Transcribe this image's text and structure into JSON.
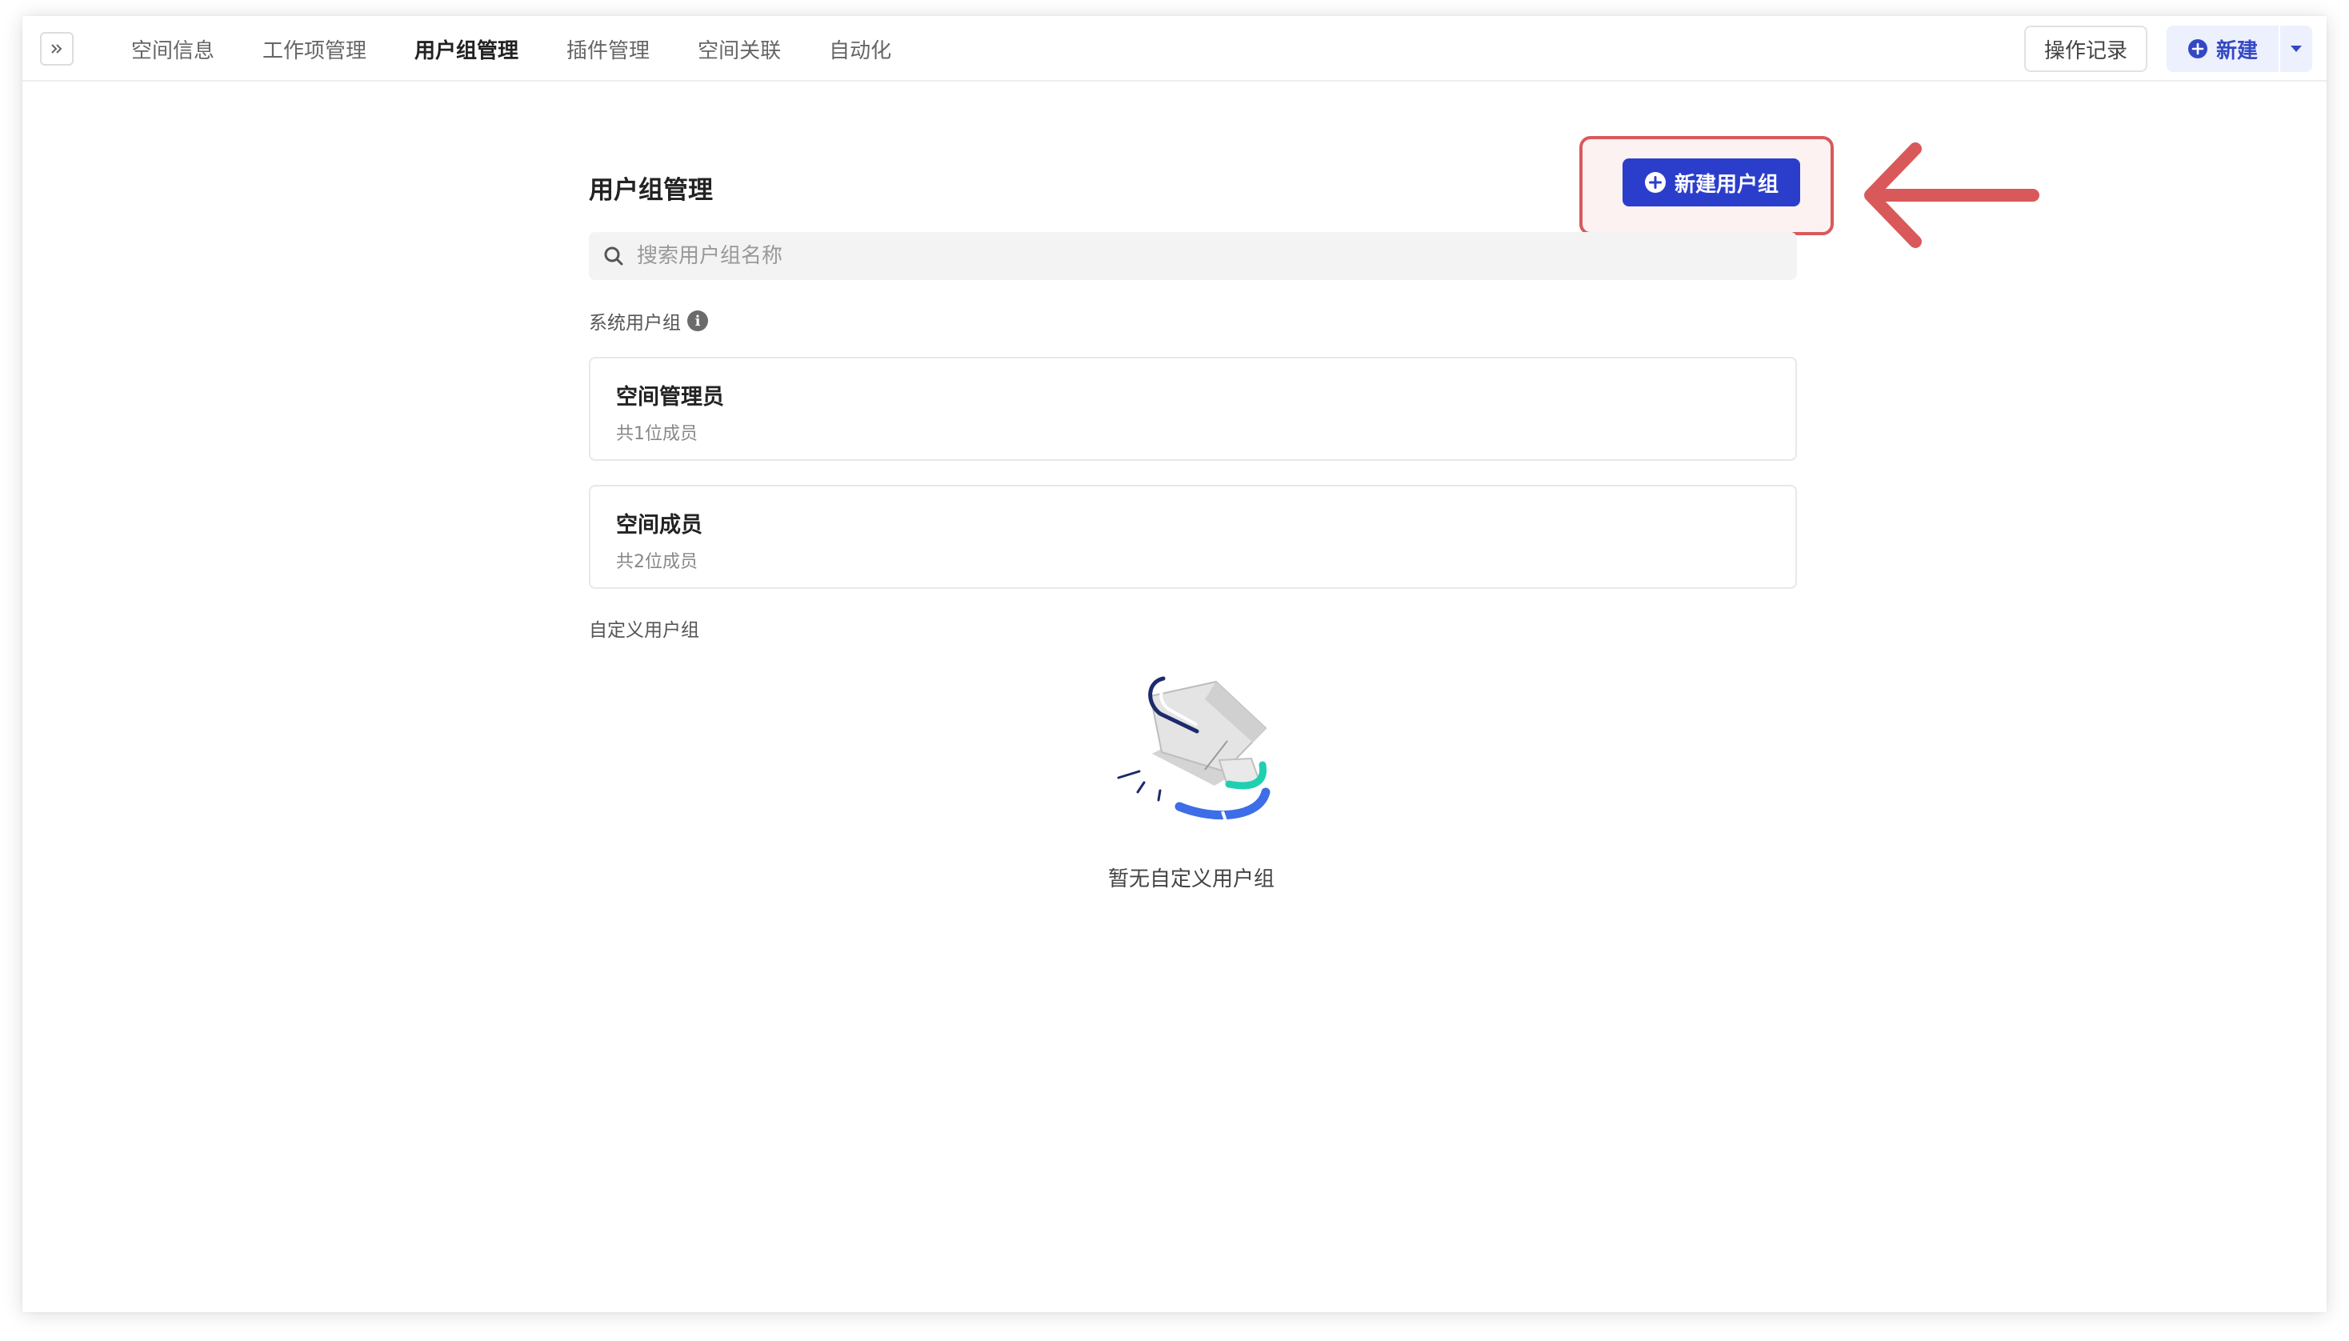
{
  "topbar": {
    "tabs": [
      {
        "label": "空间信息",
        "active": false
      },
      {
        "label": "工作项管理",
        "active": false
      },
      {
        "label": "用户组管理",
        "active": true
      },
      {
        "label": "插件管理",
        "active": false
      },
      {
        "label": "空间关联",
        "active": false
      },
      {
        "label": "自动化",
        "active": false
      }
    ],
    "history_label": "操作记录",
    "new_label": "新建",
    "new_icon": "plus-circle-icon",
    "caret_icon": "caret-down-icon",
    "expand_icon": "double-chevron-right-icon"
  },
  "main": {
    "title": "用户组管理",
    "create_button_label": "新建用户组",
    "create_button_icon": "plus-circle-icon",
    "search_placeholder": "搜索用户组名称",
    "system_groups_label": "系统用户组",
    "system_groups": [
      {
        "name": "空间管理员",
        "count": "共1位成员"
      },
      {
        "name": "空间成员",
        "count": "共2位成员"
      }
    ],
    "custom_groups_label": "自定义用户组",
    "empty_text": "暂无自定义用户组"
  },
  "colors": {
    "primary": "#2b3ecb",
    "annotation": "#d9595a",
    "new_button_bg": "#edf1fd",
    "illustration_teal": "#1fd0b0",
    "illustration_blue": "#3d6ee8",
    "illustration_navy": "#1d2a6b"
  }
}
